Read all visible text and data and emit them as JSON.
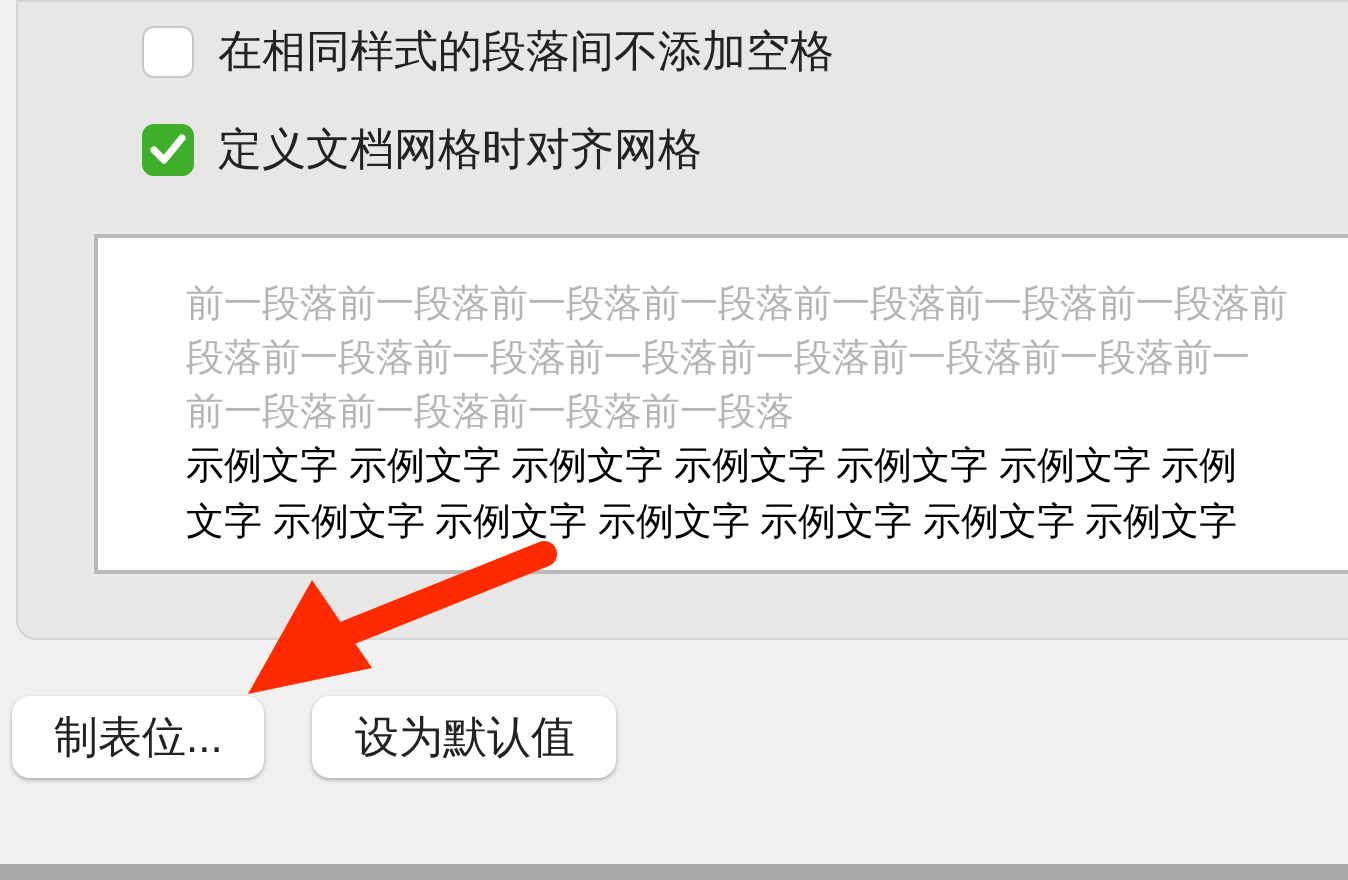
{
  "options": [
    {
      "label": "在相同样式的段落间不添加空格",
      "checked": false
    },
    {
      "label": "定义文档网格时对齐网格",
      "checked": true
    }
  ],
  "preview": {
    "previous_paragraph_lines": [
      "前一段落前一段落前一段落前一段落前一段落前一段落前一段落前",
      "段落前一段落前一段落前一段落前一段落前一段落前一段落前一",
      "前一段落前一段落前一段落前一段落"
    ],
    "sample_lines": [
      "示例文字 示例文字 示例文字 示例文字 示例文字 示例文字 示例",
      "文字 示例文字 示例文字 示例文字 示例文字 示例文字 示例文字"
    ]
  },
  "buttons": [
    "制表位...",
    "设为默认值"
  ]
}
